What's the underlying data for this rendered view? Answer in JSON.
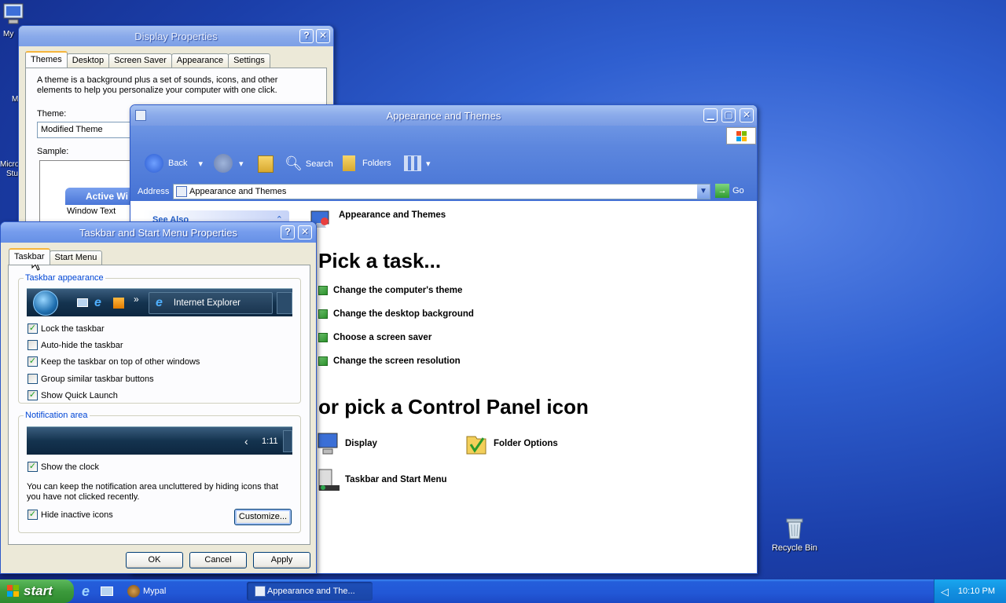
{
  "desktop": {
    "my_computer_label": "My",
    "edge_label_m": "M",
    "edge_label_micro": "Micro",
    "edge_label_stu": "Stu",
    "recycle_bin_label": "Recycle Bin"
  },
  "display_props": {
    "title": "Display Properties",
    "help_btn": "?",
    "close_btn": "✕",
    "tabs": [
      "Themes",
      "Desktop",
      "Screen Saver",
      "Appearance",
      "Settings"
    ],
    "description": "A theme is a background plus a set of sounds, icons, and other elements to help you personalize your computer with one click.",
    "theme_label": "Theme:",
    "theme_value": "Modified Theme",
    "sample_label": "Sample:",
    "sample_active_window": "Active Wi",
    "sample_window_text": "Window Text"
  },
  "explorer": {
    "title": "Appearance and Themes",
    "min_btn": "▁",
    "max_btn": "▢",
    "close_btn": "✕",
    "toolbar": {
      "back": "Back",
      "search": "Search",
      "folders": "Folders"
    },
    "address_label": "Address",
    "address_value": "Appearance and Themes",
    "go_label": "Go",
    "see_also": "See Also",
    "header": "Appearance and Themes",
    "pick_task": "Pick a task...",
    "tasks": [
      "Change the computer's theme",
      "Change the desktop background",
      "Choose a screen saver",
      "Change the screen resolution"
    ],
    "pick_icon": "or pick a Control Panel icon",
    "icons": [
      "Display",
      "Folder Options",
      "Taskbar and Start Menu"
    ]
  },
  "taskbar_props": {
    "title": "Taskbar and Start Menu Properties",
    "help_btn": "?",
    "close_btn": "✕",
    "tabs": [
      "Taskbar",
      "Start Menu"
    ],
    "appearance_group": "Taskbar appearance",
    "preview_ie": "Internet Explorer",
    "preview_more": "»",
    "checks": [
      {
        "label": "Lock the taskbar",
        "checked": true
      },
      {
        "label": "Auto-hide the taskbar",
        "checked": false
      },
      {
        "label": "Keep the taskbar on top of other windows",
        "checked": true
      },
      {
        "label": "Group similar taskbar buttons",
        "checked": false
      },
      {
        "label": "Show Quick Launch",
        "checked": true
      }
    ],
    "notification_group": "Notification area",
    "tray_preview_time": "1:11",
    "tray_preview_chevron": "‹",
    "show_clock": "Show the clock",
    "notif_text": "You can keep the notification area uncluttered by hiding icons that you have not clicked recently.",
    "hide_inactive": "Hide inactive icons",
    "customize_btn": "Customize...",
    "ok_btn": "OK",
    "cancel_btn": "Cancel",
    "apply_btn": "Apply",
    "checkmark": "✓"
  },
  "taskbar": {
    "start_label": "start",
    "task_mypal": "Mypal",
    "task_explorer": "Appearance and The...",
    "clock": "10:10 PM"
  }
}
